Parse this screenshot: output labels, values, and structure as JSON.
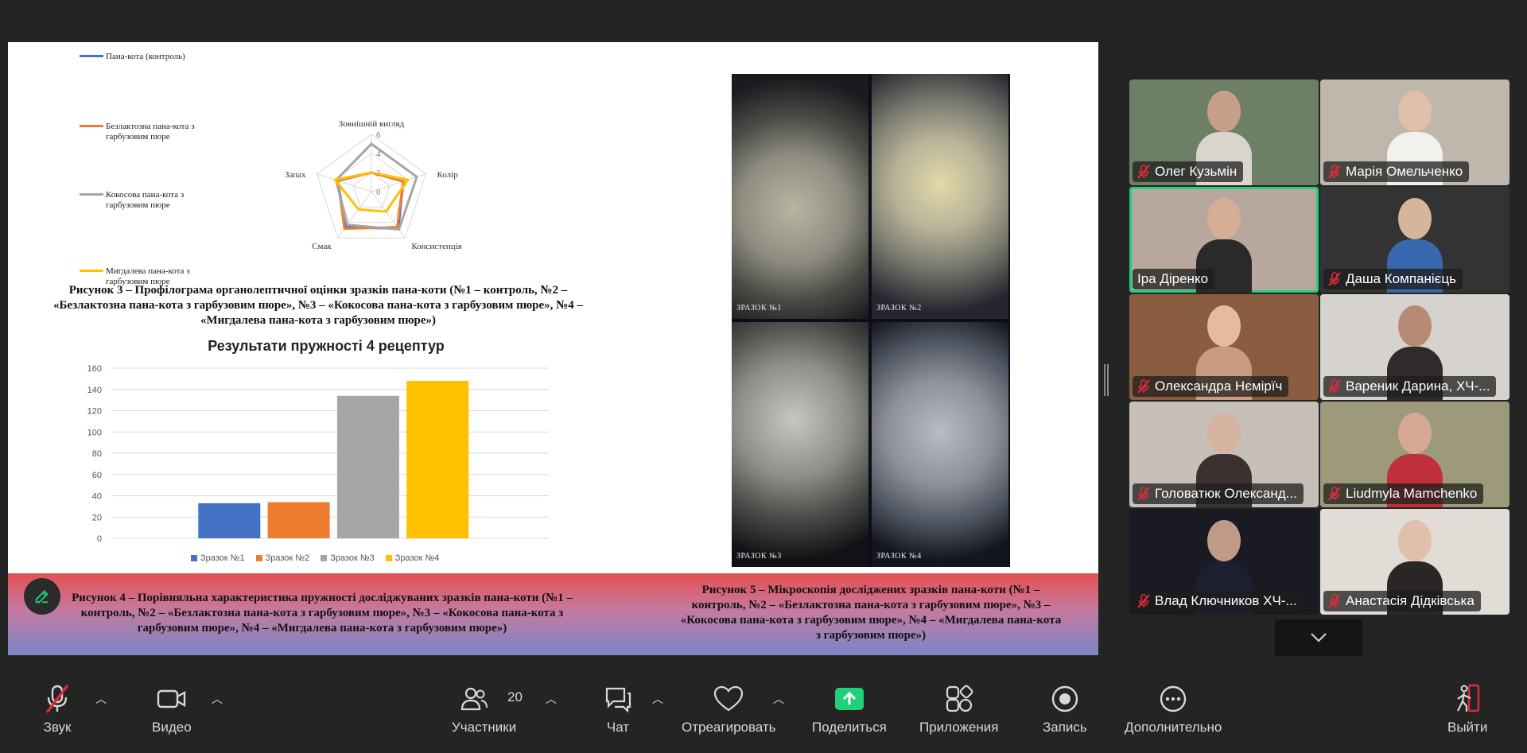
{
  "slide": {
    "radar_legend": [
      {
        "label": "Пана-кота (контроль)",
        "color": "#4472c4"
      },
      {
        "label": "Безлактозна пана-кота з гарбузовим пюре",
        "color": "#ed7d31"
      },
      {
        "label": "Кокосова пана-кота з гарбузовим пюре",
        "color": "#a5a5a5"
      },
      {
        "label": "Мигдалева пана-кота з гарбузовим пюре",
        "color": "#ffc000"
      }
    ],
    "radar_axes": [
      "Зовнішній вигляд",
      "Колір",
      "Консистенція",
      "Смак",
      "Запах"
    ],
    "radar_ticks": [
      "6",
      "4",
      "2",
      "0"
    ],
    "caption3_l1": "Рисунок 3 – Профілограма органолептичної оцінки зразків пана-коти (№1 – контроль, №2 –",
    "caption3_l2": "«Безлактозна пана-кота з гарбузовим пюре», №3 – «Кокосова пана-кота з гарбузовим пюре», №4 –",
    "caption3_l3": "«Мигдалева пана-кота з гарбузовим пюре»)",
    "photos": [
      "ЗРАЗОК №1",
      "ЗРАЗОК №2",
      "ЗРАЗОК №3",
      "ЗРАЗОК №4"
    ],
    "caption4_l1": "Рисунок 4 – Порівняльна характеристика пружності досліджуваних зразків пана-коти (№1 –",
    "caption4_l2": "контроль, №2 – «Безлактозна пана-кота з гарбузовим пюре», №3 – «Кокосова пана-кота з",
    "caption4_l3": "гарбузовим пюре», №4 – «Мигдалева пана-кота з гарбузовим пюре»)",
    "caption5_l1": "Рисунок 5 – Мікроскопія досліджених зразків пана-коти (№1 –",
    "caption5_l2": "контроль, №2 – «Безлактозна пана-кота з гарбузовим пюре», №3 –",
    "caption5_l3": "«Кокосова пана-кота з гарбузовим пюре», №4 – «Мигдалева пана-кота",
    "caption5_l4": "з гарбузовим пюре»)"
  },
  "chart_data": [
    {
      "type": "radar",
      "axes": [
        "Зовнішній вигляд",
        "Колір",
        "Консистенція",
        "Смак",
        "Запах"
      ],
      "range": [
        0,
        6
      ],
      "ticks": [
        0,
        2,
        4,
        6
      ],
      "series": [
        {
          "name": "Пана-кота (контроль)",
          "color": "#4472c4",
          "values": [
            2,
            3.5,
            4.8,
            4.6,
            3.7
          ]
        },
        {
          "name": "Безлактозна пана-кота з гарбузовим пюре",
          "color": "#ed7d31",
          "values": [
            2,
            3.5,
            4.6,
            4.8,
            3.7
          ]
        },
        {
          "name": "Кокосова пана-кота з гарбузовим пюре",
          "color": "#a5a5a5",
          "values": [
            5,
            5,
            4.9,
            4.3,
            3.9
          ]
        },
        {
          "name": "Мигдалева пана-кота з гарбузовим пюре",
          "color": "#ffc000",
          "values": [
            2,
            4,
            2.6,
            2.3,
            4
          ]
        }
      ]
    },
    {
      "type": "bar",
      "title": "Результати пружності 4 рецептур",
      "categories": [
        "Зразок №1",
        "Зразок №2",
        "Зразок №3",
        "Зразок №4"
      ],
      "colors": [
        "#4472c4",
        "#ed7d31",
        "#a5a5a5",
        "#ffc000"
      ],
      "values": [
        33,
        34,
        134,
        148
      ],
      "yticks": [
        "0",
        "20",
        "40",
        "60",
        "80",
        "100",
        "120",
        "140",
        "160"
      ],
      "ylim": [
        0,
        160
      ],
      "grid": true,
      "legend": "bottom"
    }
  ],
  "participants": [
    {
      "name": "Олег Кузьмін",
      "skin": "#c8a08a",
      "shirt": "#d9d4cc",
      "bg": "#6d7f65",
      "muted": true
    },
    {
      "name": "Марія Омельченко",
      "skin": "#e2bfa9",
      "shirt": "#f3f1ee",
      "bg": "#bfb6ac",
      "muted": true
    },
    {
      "name": "Іра Діренко",
      "skin": "#d6ad95",
      "shirt": "#2a2a2a",
      "bg": "#b8a79c",
      "muted": false,
      "active": true
    },
    {
      "name": "Даша Компанієць",
      "skin": "#d6b59b",
      "shirt": "#3a68b0",
      "bg": "#333333",
      "muted": true
    },
    {
      "name": "Олександра Нємірїч",
      "skin": "#e5bba0",
      "shirt": "#c99a80",
      "bg": "#8a5c40",
      "muted": true
    },
    {
      "name": "Вареник Дарина, ХЧ-...",
      "skin": "#b68a75",
      "shirt": "#302a2a",
      "bg": "#d6d2cd",
      "muted": true
    },
    {
      "name": "Головатюк Олександ...",
      "skin": "#d7b4a2",
      "shirt": "#3a3030",
      "bg": "#c7c0b8",
      "muted": true
    },
    {
      "name": "Liudmyla Mamchenko",
      "skin": "#d6a892",
      "shirt": "#c0303a",
      "bg": "#9c9a7a",
      "muted": true
    },
    {
      "name": "Влад Ключников ХЧ-...",
      "skin": "#bf9a86",
      "shirt": "#1e2030",
      "bg": "#1a1a22",
      "muted": true
    },
    {
      "name": "Анастасія Дідківська",
      "skin": "#e0c0ad",
      "shirt": "#2a2626",
      "bg": "#e2dcd6",
      "muted": true
    }
  ],
  "toolbar": {
    "audio": "Звук",
    "video": "Видео",
    "participants": "Участники",
    "participants_count": "20",
    "chat": "Чат",
    "react": "Отреагировать",
    "share": "Поделиться",
    "apps": "Приложения",
    "record": "Запись",
    "more": "Дополнительно",
    "leave": "Выйти",
    "share_color": "#21d07a",
    "leave_color": "#e02b3c"
  }
}
